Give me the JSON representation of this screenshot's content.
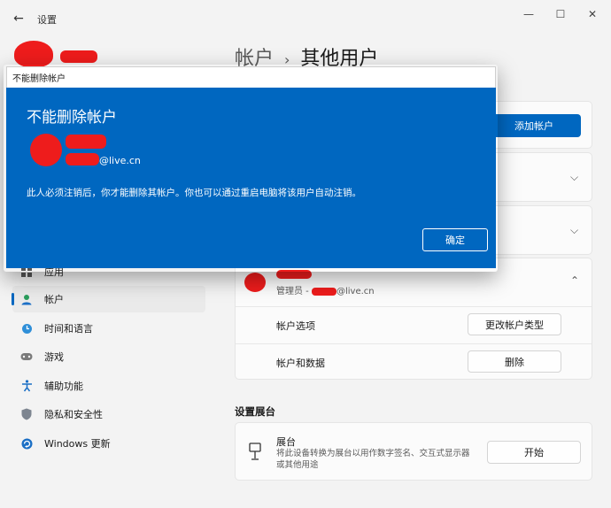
{
  "window": {
    "app_title": "设置",
    "back_glyph": "←",
    "minimize_glyph": "—",
    "maximize_glyph": "☐",
    "close_glyph": "✕"
  },
  "breadcrumb": {
    "parent": "帐户",
    "separator": "›",
    "current": "其他用户"
  },
  "sidebar": {
    "items": [
      {
        "label": "应用",
        "icon": "apps-icon"
      },
      {
        "label": "帐户",
        "icon": "account-icon",
        "active": true
      },
      {
        "label": "时间和语言",
        "icon": "globe-clock-icon"
      },
      {
        "label": "游戏",
        "icon": "gamepad-icon"
      },
      {
        "label": "辅助功能",
        "icon": "accessibility-icon"
      },
      {
        "label": "隐私和安全性",
        "icon": "shield-icon"
      },
      {
        "label": "Windows 更新",
        "icon": "windows-update-icon"
      }
    ]
  },
  "main": {
    "add_account_label": "添加帐户",
    "user_row": {
      "email_domain": "@live.cn",
      "role_prefix": "管理员 - ",
      "account_options_label": "帐户选项",
      "change_type_label": "更改帐户类型",
      "account_data_label": "帐户和数据",
      "delete_label": "删除"
    },
    "kiosk": {
      "section_title": "设置展台",
      "title": "展台",
      "description": "将此设备转换为展台以用作数字签名、交互式显示器或其他用途",
      "start_label": "开始"
    }
  },
  "dialog": {
    "window_title": "不能删除帐户",
    "heading": "不能删除帐户",
    "email_suffix": "@live.cn",
    "message": "此人必须注销后，你才能删除其帐户。你也可以通过重启电脑将该用户自动注销。",
    "ok_label": "确定"
  },
  "colors": {
    "accent": "#0067c0",
    "redaction": "#ee1c1c"
  }
}
